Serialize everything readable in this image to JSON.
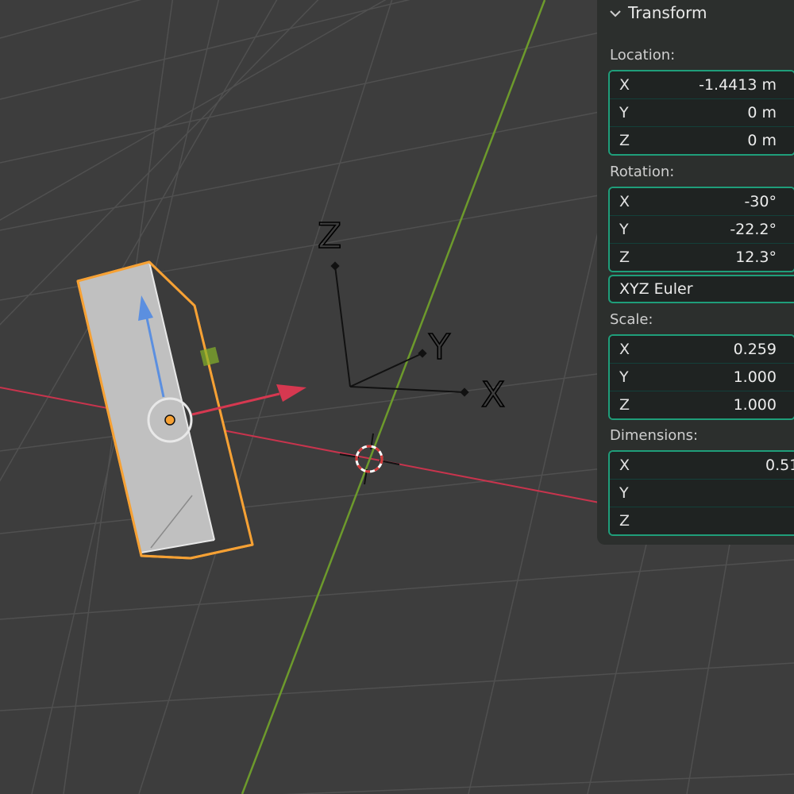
{
  "viewport": {
    "gizmo_axes": {
      "x": "X",
      "y": "Y",
      "z": "Z"
    },
    "colors": {
      "x_axis": "#c8344d",
      "y_axis": "#6d9a2c",
      "grid": "#505050",
      "selection": "#f6a134",
      "normal_arrow": "#5b8fe0"
    }
  },
  "panel": {
    "title": "Transform",
    "location": {
      "label": "Location:",
      "fields": [
        {
          "axis": "X",
          "value": "-1.4413 m"
        },
        {
          "axis": "Y",
          "value": "0 m"
        },
        {
          "axis": "Z",
          "value": "0 m"
        }
      ]
    },
    "rotation": {
      "label": "Rotation:",
      "fields": [
        {
          "axis": "X",
          "value": "-30°"
        },
        {
          "axis": "Y",
          "value": "-22.2°"
        },
        {
          "axis": "Z",
          "value": "12.3°"
        }
      ],
      "mode": "XYZ Euler"
    },
    "scale": {
      "label": "Scale:",
      "fields": [
        {
          "axis": "X",
          "value": "0.259"
        },
        {
          "axis": "Y",
          "value": "1.000"
        },
        {
          "axis": "Z",
          "value": "1.000"
        }
      ]
    },
    "dimensions": {
      "label": "Dimensions:",
      "fields": [
        {
          "axis": "X",
          "value": "0.51"
        },
        {
          "axis": "Y",
          "value": ""
        },
        {
          "axis": "Z",
          "value": ""
        }
      ]
    }
  }
}
